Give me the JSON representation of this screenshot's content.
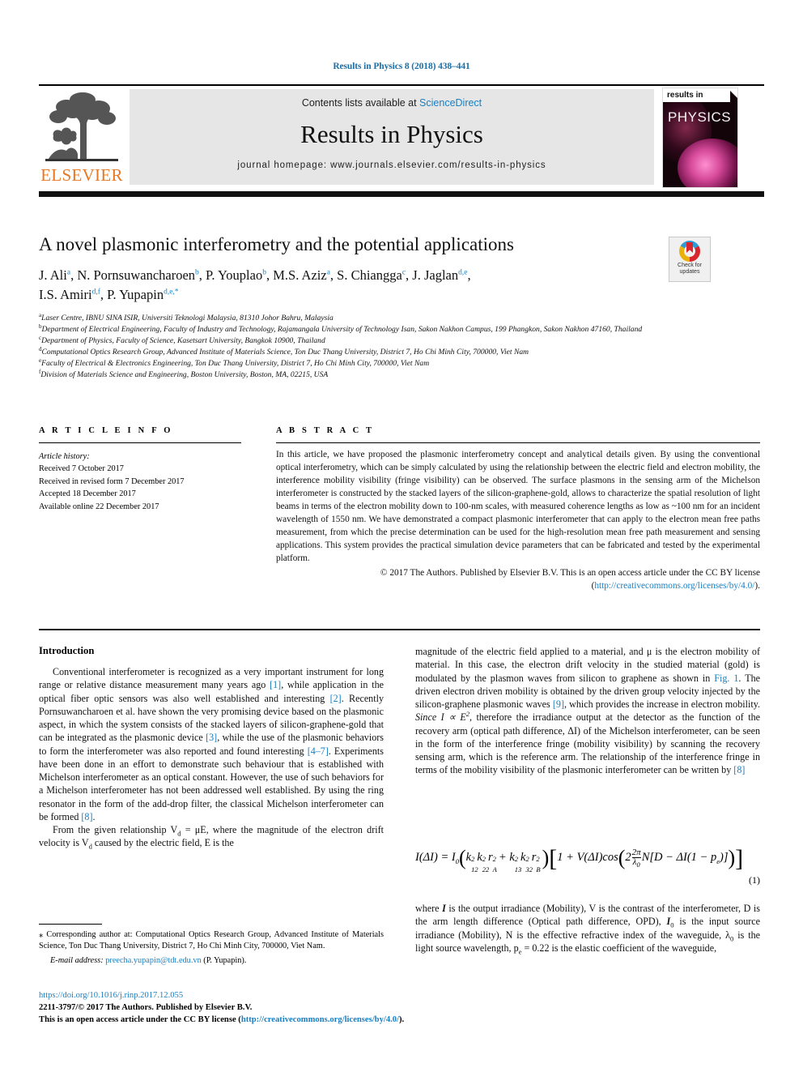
{
  "running_head": "Results in Physics 8 (2018) 438–441",
  "masthead": {
    "contents_prefix": "Contents lists available at ",
    "sciencedirect": "ScienceDirect",
    "journal_title": "Results in Physics",
    "homepage": "journal homepage: www.journals.elsevier.com/results-in-physics",
    "publisher_logo": "ELSEVIER",
    "cover": {
      "line1": "results in",
      "line2": "PHYSICS"
    },
    "accent_blue": "#1a7fc1",
    "elsevier_orange": "#E87722"
  },
  "crossmark": {
    "line1": "Check for",
    "line2": "updates",
    "icon": "crossmark-icon"
  },
  "article": {
    "title": "A novel plasmonic interferometry and the potential applications",
    "authors_line1": "J. Ali a, N. Pornsuwancharoen b, P. Youplao b, M.S. Aziz a, S. Chiangga c, J. Jaglan d,e,",
    "authors_line2": "I.S. Amiri d,f, P. Yupapin d,e,*",
    "affiliations": [
      {
        "mark": "a",
        "text": "Laser Centre, IBNU SINA ISIR, Universiti Teknologi Malaysia, 81310 Johor Bahru, Malaysia"
      },
      {
        "mark": "b",
        "text": "Department of Electrical Engineering, Faculty of Industry and Technology, Rajamangala University of Technology Isan, Sakon Nakhon Campus, 199 Phangkon, Sakon Nakhon 47160, Thailand"
      },
      {
        "mark": "c",
        "text": "Department of Physics, Faculty of Science, Kasetsart University, Bangkok 10900, Thailand"
      },
      {
        "mark": "d",
        "text": "Computational Optics Research Group, Advanced Institute of Materials Science, Ton Duc Thang University, District 7, Ho Chi Minh City, 700000, Viet Nam"
      },
      {
        "mark": "e",
        "text": "Faculty of Electrical & Electronics Engineering, Ton Duc Thang University, District 7, Ho Chi Minh City, 700000, Viet Nam"
      },
      {
        "mark": "f",
        "text": "Division of Materials Science and Engineering, Boston University, Boston, MA, 02215, USA"
      }
    ]
  },
  "article_info": {
    "header": "A R T I C L E   I N F O",
    "history_label": "Article history:",
    "history": [
      "Received 7 October 2017",
      "Received in revised form 7 December 2017",
      "Accepted 18 December 2017",
      "Available online 22 December 2017"
    ]
  },
  "abstract": {
    "header": "A B S T R A C T",
    "text": "In this article, we have proposed the plasmonic interferometry concept and analytical details given. By using the conventional optical interferometry, which can be simply calculated by using the relationship between the electric field and electron mobility, the interference mobility visibility (fringe visibility) can be observed. The surface plasmons in the sensing arm of the Michelson interferometer is constructed by the stacked layers of the silicon-graphene-gold, allows to characterize the spatial resolution of light beams in terms of the electron mobility down to 100-nm scales, with measured coherence lengths as low as ~100 nm for an incident wavelength of 1550 nm. We have demonstrated a compact plasmonic interferometer that can apply to the electron mean free paths measurement, from which the precise determination can be used for the high-resolution mean free path measurement and sensing applications. This system provides the practical simulation device parameters that can be fabricated and tested by the experimental platform.",
    "copyright": "© 2017 The Authors. Published by Elsevier B.V. This is an open access article under the CC BY license (",
    "license_link": "http://creativecommons.org/licenses/by/4.0/",
    "copyright_tail": ")."
  },
  "body": {
    "intro_heading": "Introduction",
    "left_p1_a": "Conventional interferometer is recognized as a very important instrument for long range or relative distance measurement many years ago ",
    "ref1": "[1]",
    "left_p1_b": ", while application in the optical fiber optic sensors was also well established and interesting ",
    "ref2": "[2]",
    "left_p1_c": ". Recently Pornsuwancharoen et al. have shown the very promising device based on the plasmonic aspect, in which the system consists of the stacked layers of silicon-graphene-gold that can be integrated as the plasmonic device ",
    "ref3": "[3]",
    "left_p1_d": ", while the use of the plasmonic behaviors to form the interferometer was also reported and found interesting ",
    "ref47": "[4–7]",
    "left_p1_e": ". Experiments have been done in an effort to demonstrate such behaviour that is established with Michelson interferometer as an optical constant. However, the use of such behaviors for a Michelson interferometer has not been addressed well established. By using the ring resonator in the form of the add-drop filter, the classical Michelson interferometer can be formed ",
    "ref8": "[8]",
    "left_p1_f": ".",
    "left_p2_a": "From the given relationship V",
    "left_p2_sub1": "d",
    "left_p2_b": " = μE, where the magnitude of the electron drift velocity is V",
    "left_p2_sub2": "d",
    "left_p2_c": " caused by the electric field, E is the",
    "right_p1_a": "magnitude of the electric field applied to a material, and μ is the electron mobility of material. In this case, the electron drift velocity in the studied material (gold) is modulated by the plasmon waves from silicon to graphene as shown in ",
    "fig1_link": "Fig. 1",
    "right_p1_b": ". The driven electron driven mobility is obtained by the driven group velocity injected by the silicon-graphene plasmonic waves ",
    "ref9": "[9]",
    "right_p1_c": ", which provides the increase in electron mobility. ",
    "right_p1_italic": "Since I ∝ E",
    "right_p1_italic_sup": "2",
    "right_p1_d": ", therefore the irradiance output at the detector as the function of the recovery arm (optical path difference, ΔI) of the Michelson interferometer, can be seen in the form of the interference fringe (mobility visibility) by scanning the recovery sensing arm, which is the reference arm. The relationship of the interference fringe in terms of the mobility visibility of the plasmonic interferometer can be written by ",
    "ref8b": "[8]",
    "equation_number": "(1)",
    "right_p2_a": "where ",
    "right_p2_I": "I",
    "right_p2_b": " is the output irradiance (Mobility), V is the contrast of the interferometer, D is the arm length difference (Optical path difference, OPD), ",
    "right_p2_I0": "I",
    "right_p2_I0sub": "0",
    "right_p2_c": " is the input source irradiance (Mobility), N is the effective refractive index of the waveguide, λ",
    "right_p2_lsub": "0",
    "right_p2_d": " is the light source wavelength, p",
    "right_p2_psub": "e",
    "right_p2_e": " = 0.22 is the elastic coefficient of the waveguide,"
  },
  "footnote": {
    "star": "⁎",
    "corresponding": " Corresponding author at: Computational Optics Research Group, Advanced Institute of Materials Science, Ton Duc Thang University, District 7, Ho Chi Minh City, 700000, Viet Nam.",
    "email_label": "E-mail address:",
    "email": "preecha.yupapin@tdt.edu.vn",
    "email_suffix": " (P. Yupapin)."
  },
  "footer": {
    "doi": "https://doi.org/10.1016/j.rinp.2017.12.055",
    "issn_line": "2211-3797/© 2017 The Authors. Published by Elsevier B.V.",
    "license_prefix": "This is an open access article under the CC BY license (",
    "license_url": "http://creativecommons.org/licenses/by/4.0/",
    "license_suffix": ")."
  }
}
